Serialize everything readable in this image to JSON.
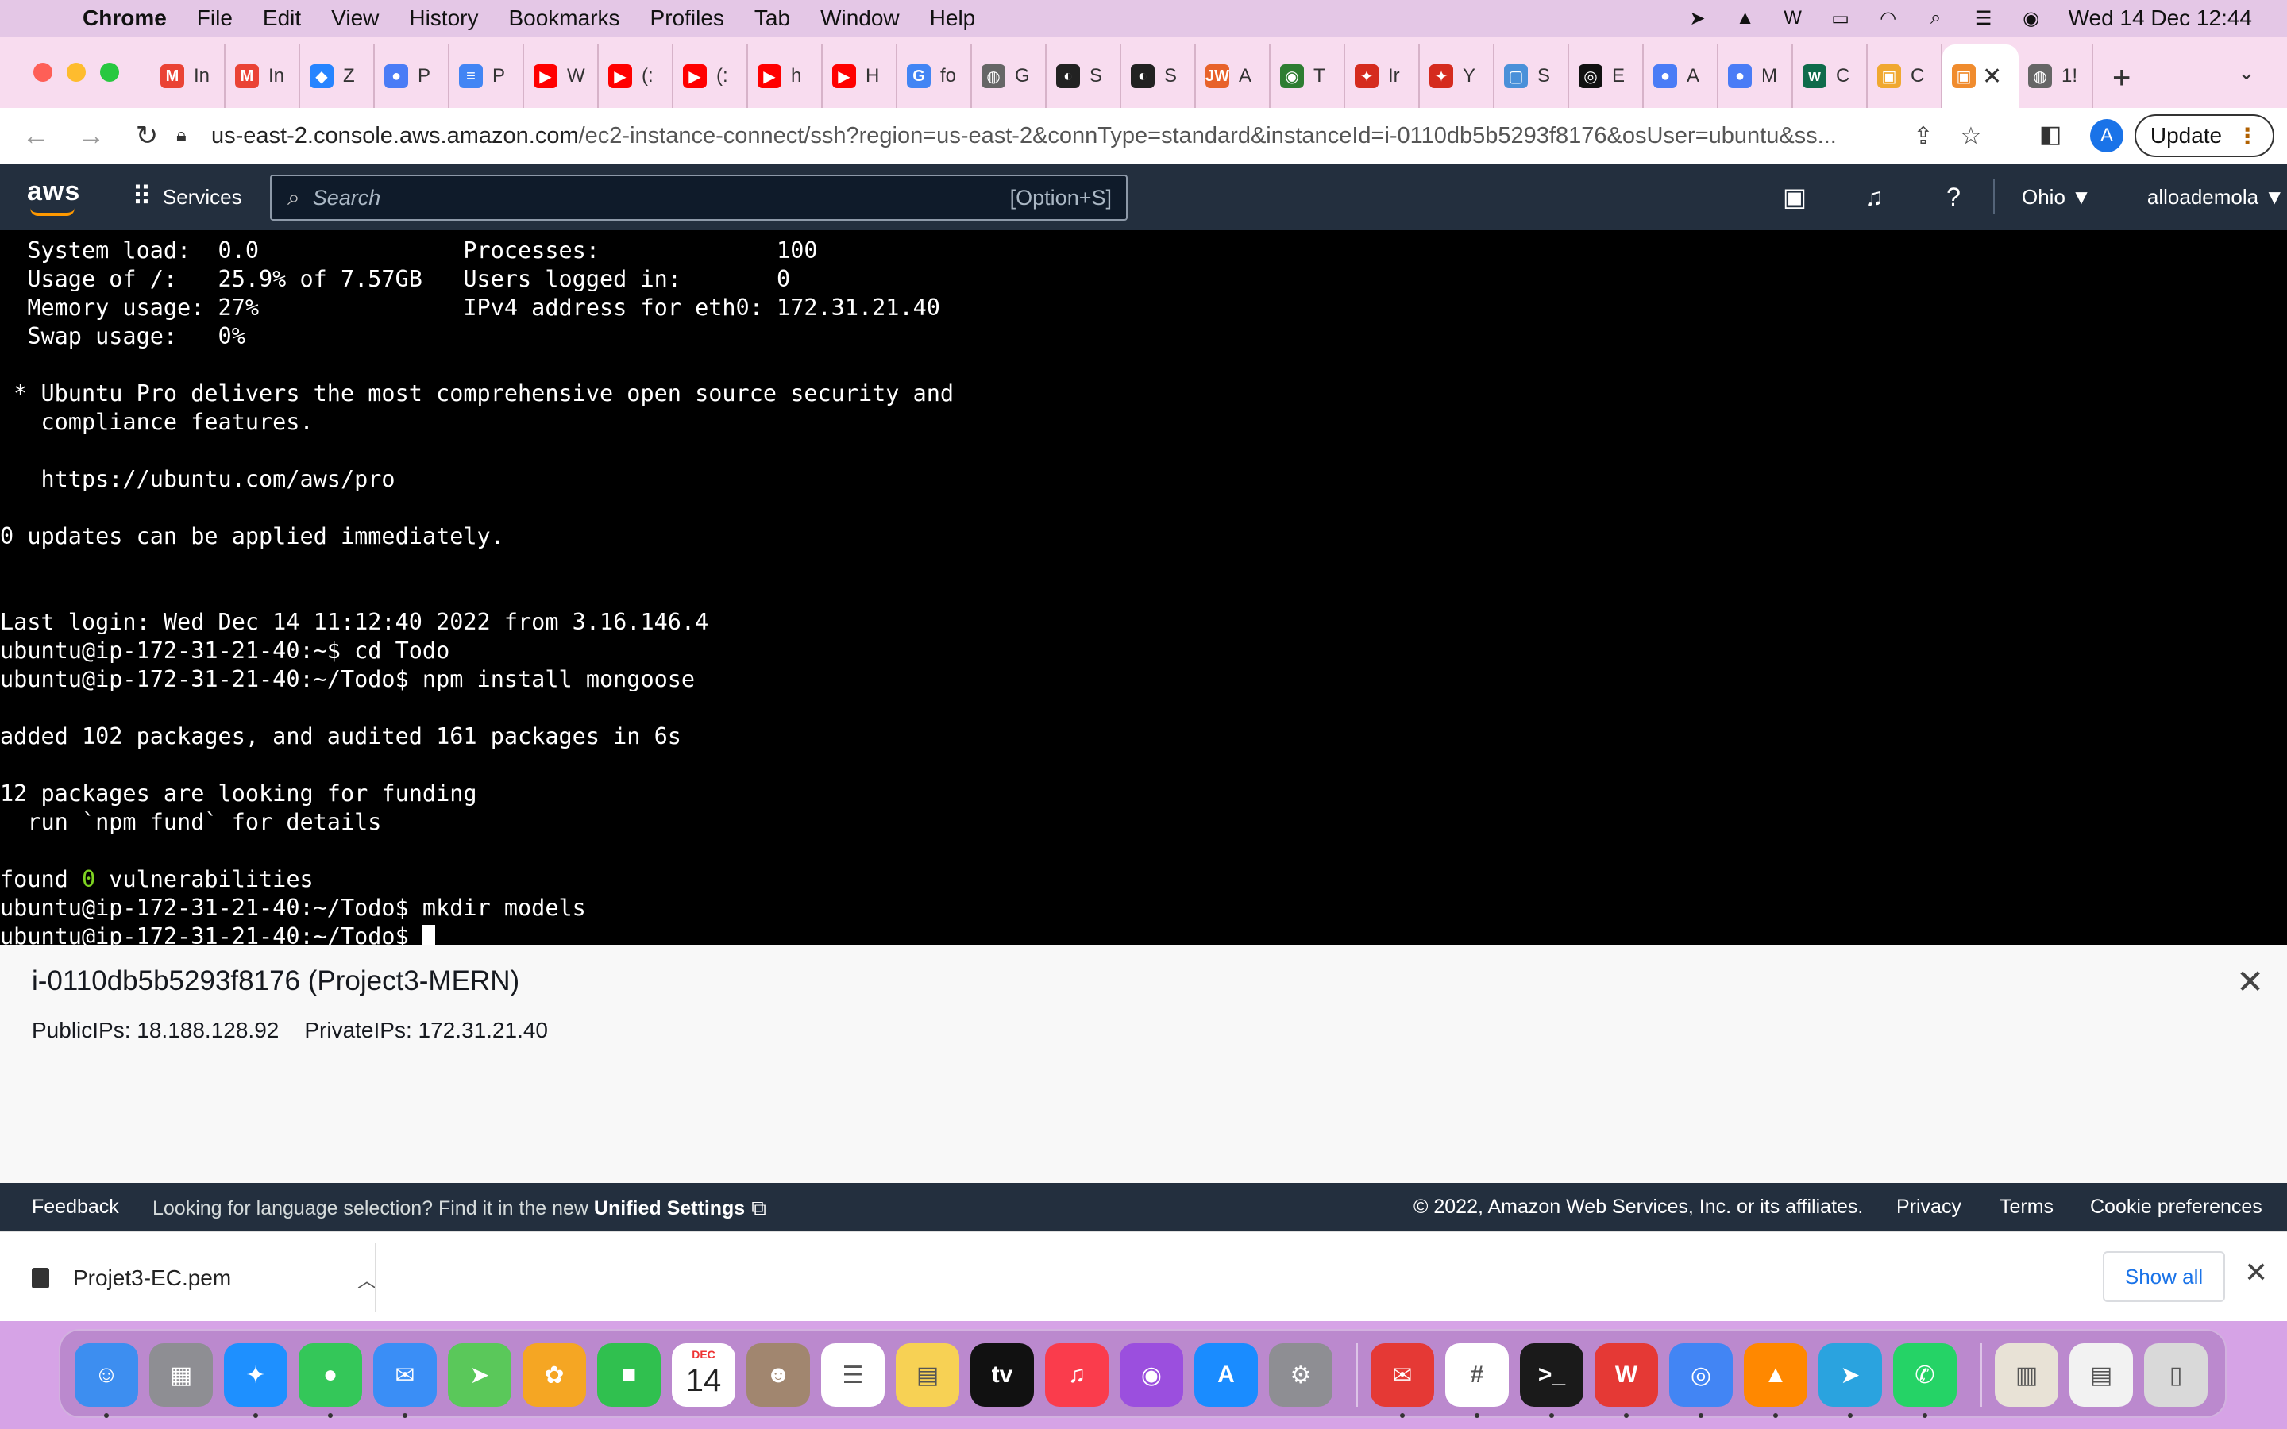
{
  "menubar": {
    "app_name": "Chrome",
    "items": [
      "File",
      "Edit",
      "View",
      "History",
      "Bookmarks",
      "Profiles",
      "Tab",
      "Window",
      "Help"
    ],
    "clock": "Wed 14 Dec  12:44"
  },
  "tabs": [
    {
      "letter": "In",
      "icon": "gmail-icon",
      "color": "#ea4335",
      "glyph": "M"
    },
    {
      "letter": "In",
      "icon": "gmail-icon",
      "color": "#ea4335",
      "glyph": "M"
    },
    {
      "letter": "Z",
      "icon": "jira-icon",
      "color": "#2684ff",
      "glyph": "◆"
    },
    {
      "letter": "P",
      "icon": "slack-like-icon",
      "color": "#4a7cf6",
      "glyph": "●"
    },
    {
      "letter": "P",
      "icon": "google-docs-icon",
      "color": "#4285f4",
      "glyph": "≡"
    },
    {
      "letter": "W",
      "icon": "youtube-icon",
      "color": "#ff0000",
      "glyph": "▶"
    },
    {
      "letter": "(:",
      "icon": "youtube-icon",
      "color": "#ff0000",
      "glyph": "▶"
    },
    {
      "letter": "(:",
      "icon": "youtube-icon",
      "color": "#ff0000",
      "glyph": "▶"
    },
    {
      "letter": "h",
      "icon": "youtube-icon",
      "color": "#ff0000",
      "glyph": "▶"
    },
    {
      "letter": "H",
      "icon": "youtube-icon",
      "color": "#ff0000",
      "glyph": "▶"
    },
    {
      "letter": "fo",
      "icon": "google-icon",
      "color": "#4285f4",
      "glyph": "G"
    },
    {
      "letter": "G",
      "icon": "globe-icon",
      "color": "#666666",
      "glyph": "◍"
    },
    {
      "letter": "S",
      "icon": "site-icon",
      "color": "#222222",
      "glyph": "◐"
    },
    {
      "letter": "S",
      "icon": "site-icon",
      "color": "#222222",
      "glyph": "◐"
    },
    {
      "letter": "A",
      "icon": "jw-icon",
      "color": "#e8622a",
      "glyph": "JW"
    },
    {
      "letter": "T",
      "icon": "site-icon",
      "color": "#2e7d32",
      "glyph": "◉"
    },
    {
      "letter": "Ir",
      "icon": "canada-icon",
      "color": "#d52b1e",
      "glyph": "✦"
    },
    {
      "letter": "Y",
      "icon": "canada-icon",
      "color": "#d52b1e",
      "glyph": "✦"
    },
    {
      "letter": "S",
      "icon": "bookmark-icon",
      "color": "#4a90d9",
      "glyph": "▢"
    },
    {
      "letter": "E",
      "icon": "github-icon",
      "color": "#111111",
      "glyph": "◎"
    },
    {
      "letter": "A",
      "icon": "slack-like-icon",
      "color": "#4a7cf6",
      "glyph": "●"
    },
    {
      "letter": "M",
      "icon": "slack-like-icon",
      "color": "#4a7cf6",
      "glyph": "●"
    },
    {
      "letter": "C",
      "icon": "site-icon",
      "color": "#0f6b4b",
      "glyph": "w"
    },
    {
      "letter": "C",
      "icon": "box-icon",
      "color": "#f0a830",
      "glyph": "▣"
    },
    {
      "letter": "",
      "icon": "aws-cube-icon",
      "color": "#f08c2e",
      "glyph": "▣",
      "active": true
    },
    {
      "letter": "1!",
      "icon": "globe-icon",
      "color": "#666666",
      "glyph": "◍"
    }
  ],
  "toolbar": {
    "url_host": "us-east-2.console.aws.amazon.com",
    "url_path": "/ec2-instance-connect/ssh?region=us-east-2&connType=standard&instanceId=i-0110db5b5293f8176&osUser=ubuntu&ss...",
    "profile_initial": "A",
    "update_label": "Update"
  },
  "aws": {
    "logo": "aws",
    "services_label": "Services",
    "search_placeholder": "Search",
    "search_shortcut": "[Option+S]",
    "region": "Ohio ▼",
    "user": "alloademola ▼"
  },
  "terminal": {
    "lines": [
      "  System load:  0.0               Processes:             100",
      "  Usage of /:   25.9% of 7.57GB   Users logged in:       0",
      "  Memory usage: 27%               IPv4 address for eth0: 172.31.21.40",
      "  Swap usage:   0%",
      "",
      " * Ubuntu Pro delivers the most comprehensive open source security and",
      "   compliance features.",
      "",
      "   https://ubuntu.com/aws/pro",
      "",
      "0 updates can be applied immediately.",
      "",
      "",
      "Last login: Wed Dec 14 11:12:40 2022 from 3.16.146.4",
      "ubuntu@ip-172-31-21-40:~$ cd Todo",
      "ubuntu@ip-172-31-21-40:~/Todo$ npm install mongoose",
      "",
      "added 102 packages, and audited 161 packages in 6s",
      "",
      "12 packages are looking for funding",
      "  run `npm fund` for details",
      ""
    ],
    "vuln_prefix": "found ",
    "vuln_count": "0",
    "vuln_suffix": " vulnerabilities",
    "cmd_line": "ubuntu@ip-172-31-21-40:~/Todo$ mkdir models",
    "prompt": "ubuntu@ip-172-31-21-40:~/Todo$ "
  },
  "instance": {
    "title": "i-0110db5b5293f8176 (Project3-MERN)",
    "public_ips": "PublicIPs: 18.188.128.92",
    "private_ips": "PrivateIPs: 172.31.21.40"
  },
  "footer": {
    "feedback": "Feedback",
    "hint": "Looking for language selection? Find it in the new ",
    "hint_link": "Unified Settings",
    "copyright": "© 2022, Amazon Web Services, Inc. or its affiliates.",
    "privacy": "Privacy",
    "terms": "Terms",
    "cookies": "Cookie preferences"
  },
  "downloads": {
    "file_name": "Projet3-EC.pem",
    "show_all": "Show all"
  },
  "dock": {
    "calendar_month": "DEC",
    "calendar_day": "14",
    "apps": [
      {
        "name": "finder-icon",
        "color": "#3d8ef0",
        "glyph": "☺",
        "dot": true
      },
      {
        "name": "launchpad-icon",
        "color": "#8e8e93",
        "glyph": "▦",
        "dot": false
      },
      {
        "name": "safari-icon",
        "color": "#1e90ff",
        "glyph": "✦",
        "dot": true
      },
      {
        "name": "messages-icon",
        "color": "#34c759",
        "glyph": "●",
        "dot": true
      },
      {
        "name": "mail-icon",
        "color": "#3a8ef6",
        "glyph": "✉",
        "dot": true
      },
      {
        "name": "maps-icon",
        "color": "#5ac85a",
        "glyph": "➤",
        "dot": false
      },
      {
        "name": "photos-icon",
        "color": "#f5a623",
        "glyph": "✿",
        "dot": false
      },
      {
        "name": "facetime-icon",
        "color": "#30c04f",
        "glyph": "■",
        "dot": false
      },
      {
        "name": "calendar-icon",
        "color": "#ffffff",
        "glyph": "",
        "dot": false
      },
      {
        "name": "contacts-icon",
        "color": "#a1866f",
        "glyph": "☻",
        "dot": false
      },
      {
        "name": "reminders-icon",
        "color": "#ffffff",
        "glyph": "☰",
        "dot": false
      },
      {
        "name": "notes-icon",
        "color": "#f7d154",
        "glyph": "▤",
        "dot": false
      },
      {
        "name": "appletv-icon",
        "color": "#111111",
        "glyph": "tv",
        "dot": false
      },
      {
        "name": "music-icon",
        "color": "#fa3c4c",
        "glyph": "♫",
        "dot": false
      },
      {
        "name": "podcasts-icon",
        "color": "#9b4fde",
        "glyph": "◉",
        "dot": false
      },
      {
        "name": "appstore-icon",
        "color": "#1a8cff",
        "glyph": "A",
        "dot": false
      },
      {
        "name": "settings-icon",
        "color": "#8e8e93",
        "glyph": "⚙",
        "dot": false
      },
      {
        "sep": true
      },
      {
        "name": "airmail-icon",
        "color": "#e53935",
        "glyph": "✉",
        "dot": true
      },
      {
        "name": "slack-icon",
        "color": "#ffffff",
        "glyph": "#",
        "dot": true
      },
      {
        "name": "terminal-icon",
        "color": "#1a1a1a",
        "glyph": ">_",
        "dot": true
      },
      {
        "name": "wps-icon",
        "color": "#e53935",
        "glyph": "W",
        "dot": true
      },
      {
        "name": "chrome-icon",
        "color": "#4285f4",
        "glyph": "◎",
        "dot": true
      },
      {
        "name": "vlc-icon",
        "color": "#ff8800",
        "glyph": "▲",
        "dot": true
      },
      {
        "name": "telegram-icon",
        "color": "#2aa3df",
        "glyph": "➤",
        "dot": true
      },
      {
        "name": "whatsapp-icon",
        "color": "#25d366",
        "glyph": "✆",
        "dot": true
      },
      {
        "sep": true
      },
      {
        "name": "document-icon",
        "color": "#e8e2d6",
        "glyph": "▥",
        "dot": false
      },
      {
        "name": "document-icon",
        "color": "#f2f2f2",
        "glyph": "▤",
        "dot": false
      },
      {
        "name": "trash-icon",
        "color": "#d9d9d9",
        "glyph": "▯",
        "dot": false
      }
    ]
  }
}
